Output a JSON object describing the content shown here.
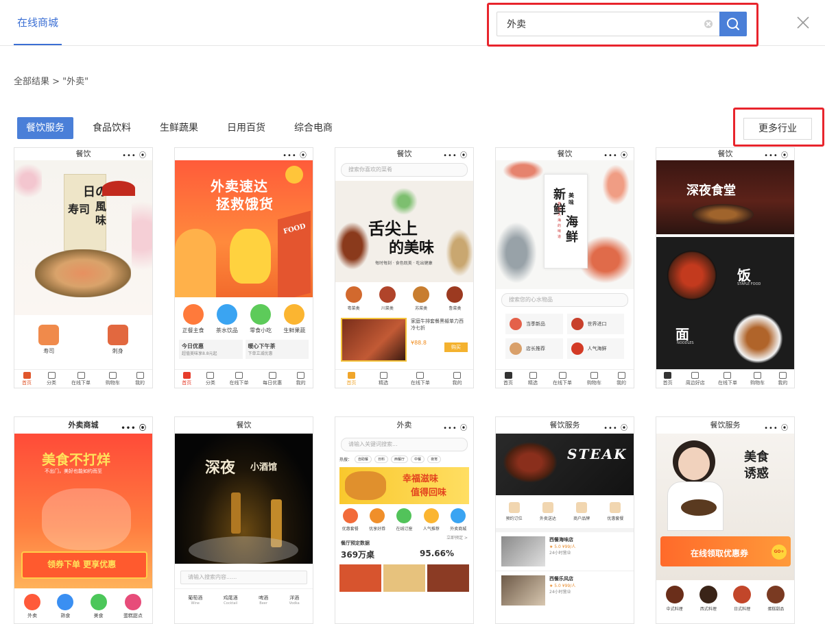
{
  "header": {
    "tab_active": "在线商城",
    "search_value": "外卖"
  },
  "breadcrumb": "全部结果 > \"外卖\"",
  "categories": [
    "餐饮服务",
    "食品饮料",
    "生鲜蔬果",
    "日用百货",
    "综合电商"
  ],
  "more_label": "更多行业",
  "colors": {
    "accent": "#4a7fd8",
    "highlight": "#e8242c"
  },
  "cards": [
    {
      "title": "餐饮",
      "capsule": "•••  ⦿",
      "banner": [
        "日の",
        "寿司",
        "風味"
      ],
      "items": [
        "寿司",
        "刺身"
      ],
      "tabs": [
        "首页",
        "分类",
        "在线下单",
        "购物车",
        "我的"
      ]
    },
    {
      "title": "",
      "capsule": "•••  ⦿",
      "banner": [
        "外卖速达",
        "拯救饿货",
        "FOOD"
      ],
      "icons": [
        "正餐主食",
        "茶水饮品",
        "零食小吃",
        "生鲜果蔬"
      ],
      "promo": [
        "今日优惠",
        "超值美味享8.8元起",
        "暖心下午茶",
        "下单立减优惠"
      ],
      "tabs": [
        "首页",
        "分类",
        "在线下单",
        "每日优惠",
        "我的"
      ]
    },
    {
      "title": "餐饮",
      "capsule": "•••  ⦿",
      "search": "搜索你喜欢的菜肴",
      "banner": [
        "舌尖上",
        "的美味",
        "每时每刻 · 食色既美 · 吃出健康"
      ],
      "icons": [
        "粤菜类",
        "川菜类",
        "苏菜类",
        "鲁菜类"
      ],
      "product": [
        "家庭牛排套餐黑椒单力西冷七折",
        "¥88.8",
        "购买"
      ],
      "tabs": [
        "首页",
        "精选",
        "在线下单",
        "我的"
      ]
    },
    {
      "title": "餐饮",
      "capsule": "•••  ⦿",
      "banner": [
        "新",
        "鲜",
        "美味",
        "海",
        "鲜",
        "尝尝大海的味道"
      ],
      "search": "搜索您的心水物品",
      "grid": [
        "当季新品",
        "世界进口",
        "店长推荐",
        "人气海鲜"
      ],
      "tabs": [
        "首页",
        "精选",
        "在线下单",
        "购物车",
        "我的"
      ]
    },
    {
      "title": "餐饮",
      "capsule": "•••  ⦿",
      "banner": [
        "深夜食堂",
        "饭",
        "STAPLE FOOD",
        "面",
        "NOODLES"
      ],
      "tabs": [
        "首页",
        "周边好店",
        "在线下单",
        "购物车",
        "我的"
      ]
    },
    {
      "title": "外卖商城",
      "capsule": "•••  ⦿",
      "banner": [
        "美食不打烊",
        "不出门，美好也能如约而至",
        "领券下单 更享优惠"
      ],
      "icons": [
        "外卖",
        "熟食",
        "美食",
        "蛋糕甜点"
      ]
    },
    {
      "title": "餐饮",
      "capsule": "",
      "banner": [
        "深夜",
        "小酒馆"
      ],
      "search": "请输入搜索内容......",
      "drinks": [
        [
          "葡萄酒",
          "Wine"
        ],
        [
          "鸡尾酒",
          "Cocktail"
        ],
        [
          "啤酒",
          "Beer"
        ],
        [
          "洋酒",
          "Vodka"
        ]
      ]
    },
    {
      "title": "外卖",
      "capsule": "•••  ⦿",
      "search": "请输入关键词搜索...",
      "hot_label": "热搜：",
      "hot": [
        "自助餐",
        "日料",
        "西餐厅",
        "中餐",
        "夜宵"
      ],
      "banner": [
        "幸福滋味",
        "值得回味"
      ],
      "icons": [
        "优惠套餐",
        "优享好券",
        "在线订座",
        "人气推荐",
        "外卖商城"
      ],
      "stats": [
        "餐厅预定数据",
        "立即预定 >",
        "369万桌",
        "95.66%"
      ]
    },
    {
      "title": "餐饮服务",
      "capsule": "•••  ⦿",
      "banner": [
        "STEAK"
      ],
      "icons": [
        "预约订位",
        "外卖送达",
        "商户品牌",
        "优惠套餐"
      ],
      "shops": [
        [
          "西餐海味店",
          "★ 5.0  ¥99/人",
          "24小时营业"
        ],
        [
          "西餐乐风店",
          "★ 5.0  ¥99/人",
          "24小时营业"
        ]
      ]
    },
    {
      "title": "餐饮服务",
      "capsule": "•••  ⦿",
      "banner": [
        "美食",
        "诱惑",
        "在线领取优惠券",
        "GO+"
      ],
      "icons": [
        "中式料理",
        "西式料理",
        "日式料理",
        "蛋糕甜品"
      ]
    }
  ]
}
